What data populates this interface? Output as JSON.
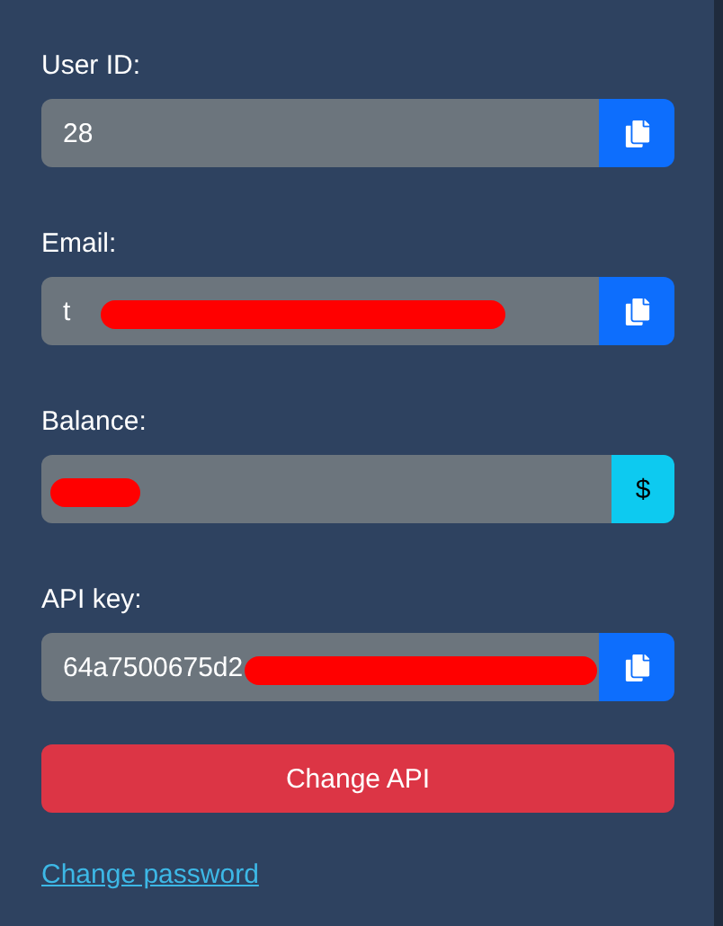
{
  "fields": [
    {
      "label": "User ID:",
      "value": "28",
      "kind": "copy",
      "redacted": false
    },
    {
      "label": "Email:",
      "value": "t",
      "kind": "copy",
      "redacted": true
    },
    {
      "label": "Balance:",
      "kind": "addon",
      "addon": "$",
      "redacted": true
    },
    {
      "label": "API key:",
      "value": "64a7500675d2",
      "kind": "copy",
      "redacted": true
    }
  ],
  "button": "Change API",
  "link": "Change password"
}
